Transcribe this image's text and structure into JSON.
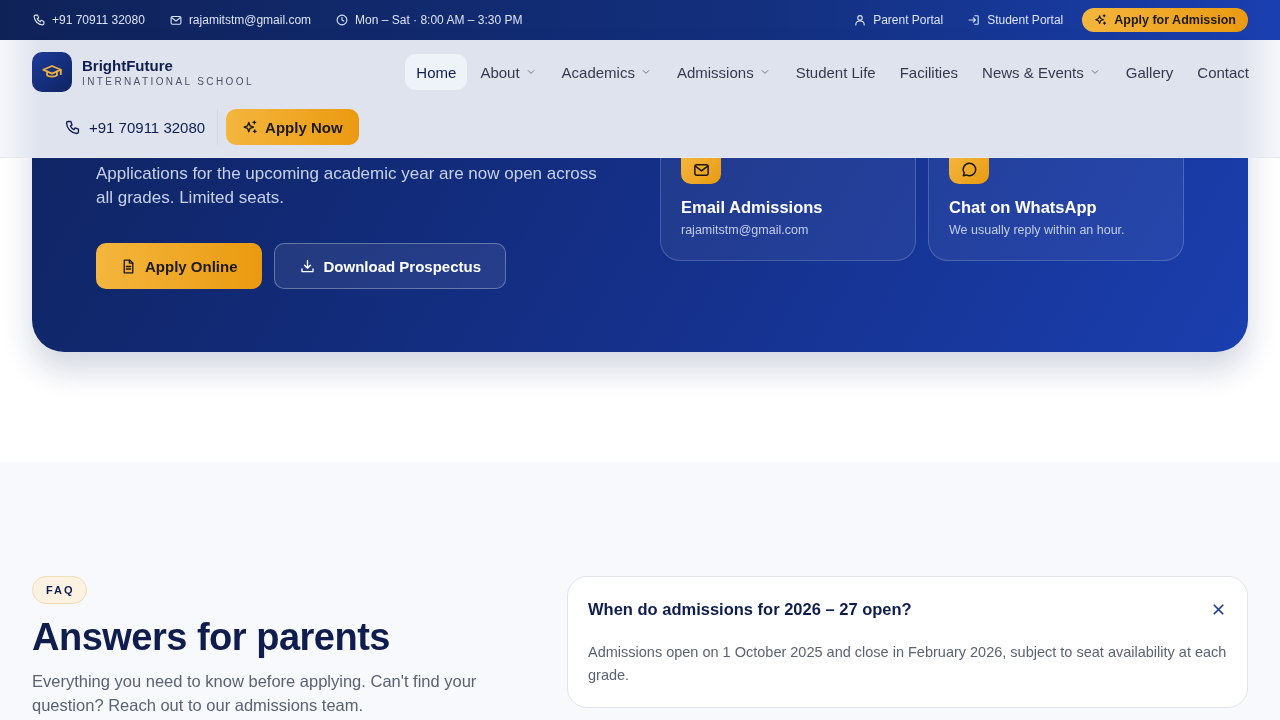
{
  "top_bar": {
    "contacts": [
      {
        "kind": "phone",
        "text": "+91 70911 32080"
      },
      {
        "kind": "email",
        "text": "rajamitstm@gmail.com"
      },
      {
        "kind": "clock",
        "text": "Mon – Sat · 8:00 AM – 3:30 PM"
      }
    ],
    "links": [
      {
        "kind": "user",
        "label": "Parent Portal"
      },
      {
        "kind": "login",
        "label": "Student Portal"
      }
    ],
    "cta": "Apply for Admission"
  },
  "header": {
    "brand": {
      "name": "BrightFuture",
      "tagline": "INTERNATIONAL SCHOOL"
    },
    "nav": [
      {
        "label": "Home",
        "selected": true,
        "dropdown": false
      },
      {
        "label": "About",
        "selected": false,
        "dropdown": true
      },
      {
        "label": "Academics",
        "selected": false,
        "dropdown": true
      },
      {
        "label": "Admissions",
        "selected": false,
        "dropdown": true
      },
      {
        "label": "Student Life",
        "selected": false,
        "dropdown": false
      },
      {
        "label": "Facilities",
        "selected": false,
        "dropdown": false
      },
      {
        "label": "News & Events",
        "selected": false,
        "dropdown": true
      },
      {
        "label": "Gallery",
        "selected": false,
        "dropdown": false
      },
      {
        "label": "Contact",
        "selected": false,
        "dropdown": false
      }
    ],
    "phone": "+91 70911 32080",
    "cta": "Apply Now"
  },
  "hero": {
    "description": "Applications for the upcoming academic year are now open across all grades. Limited seats.",
    "buttons": [
      {
        "kind": "primary",
        "label": "Apply Online"
      },
      {
        "kind": "outline",
        "label": "Download Prospectus"
      }
    ],
    "contact_cards": [
      {
        "kind": "email",
        "title": "Email Admissions",
        "detail": "rajamitstm@gmail.com"
      },
      {
        "kind": "chat",
        "title": "Chat on WhatsApp",
        "detail": "We usually reply within an hour."
      }
    ]
  },
  "faq": {
    "badge": "FAQ",
    "title": "Answers for parents",
    "description": "Everything you need to know before applying. Can't find your question? Reach out to our admissions team.",
    "items": [
      {
        "question": "When do admissions for 2026 – 27 open?",
        "answer": "Admissions open on 1 October 2025 and close in February 2026, subject to seat availability at each grade.",
        "expanded": true
      }
    ]
  }
}
